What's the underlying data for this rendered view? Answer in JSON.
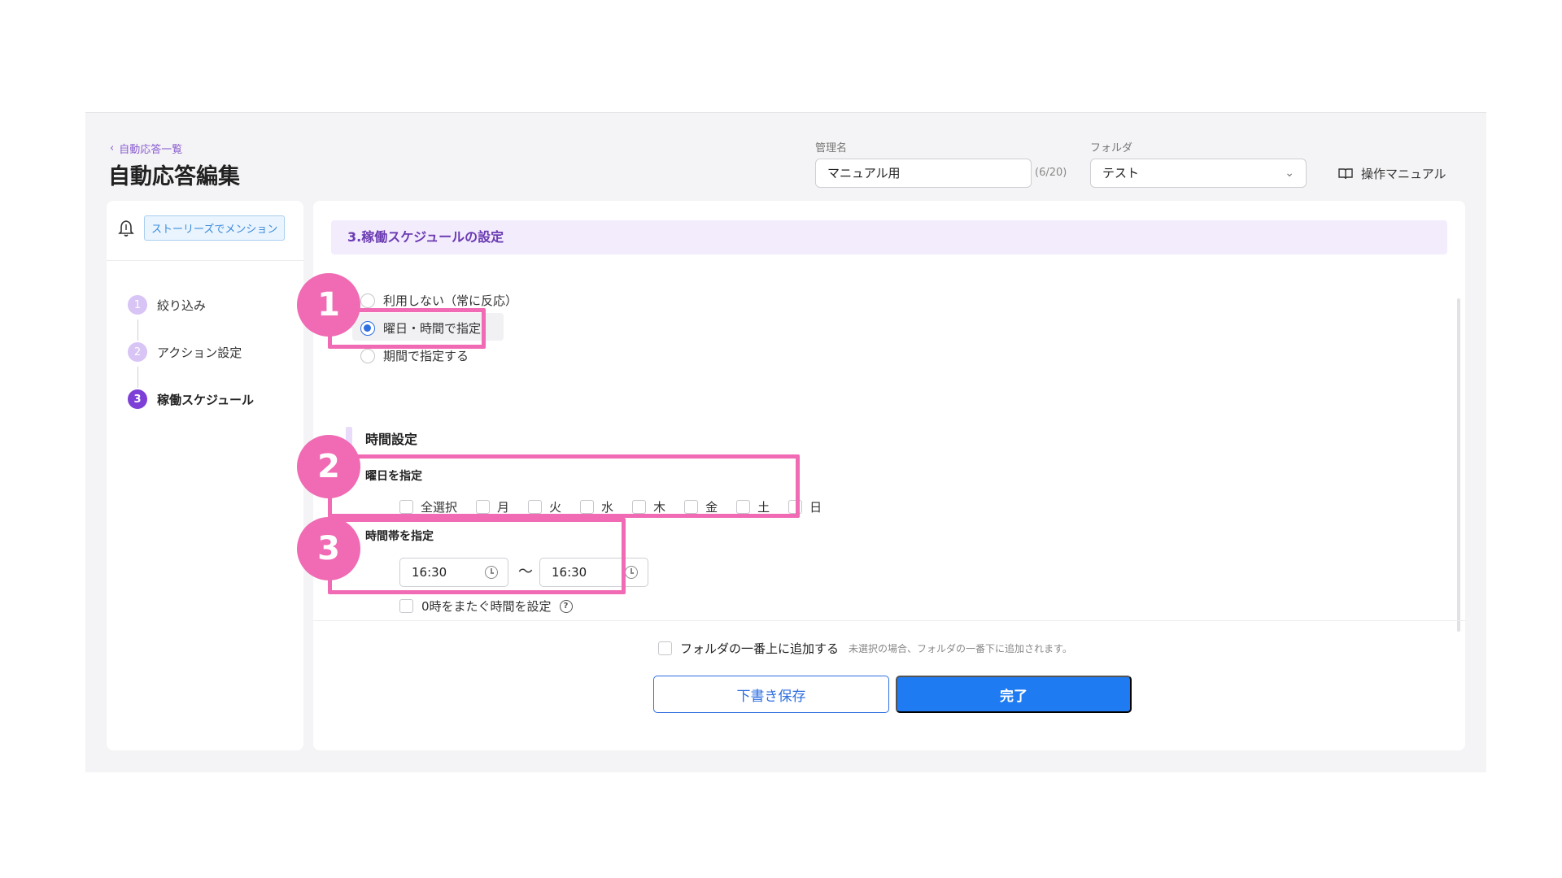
{
  "header": {
    "back_link": "自動応答一覧",
    "page_title": "自動応答編集",
    "name_label": "管理名",
    "name_value": "マニュアル用",
    "name_counter": "(6/20)",
    "folder_label": "フォルダ",
    "folder_value": "テスト",
    "manual_link": "操作マニュアル"
  },
  "sidebar": {
    "trigger_tag": "ストーリーズでメンション",
    "steps": [
      {
        "num": "1",
        "label": "絞り込み"
      },
      {
        "num": "2",
        "label": "アクション設定"
      },
      {
        "num": "3",
        "label": "稼働スケジュール"
      }
    ]
  },
  "schedule": {
    "section_title": "3.稼働スケジュールの設定",
    "options": [
      {
        "label": "利用しない（常に反応）",
        "selected": false
      },
      {
        "label": "曜日・時間で指定",
        "selected": true
      },
      {
        "label": "期間で指定する",
        "selected": false
      }
    ],
    "time_settings_title": "時間設定",
    "days_label": "曜日を指定",
    "days": [
      "全選択",
      "月",
      "火",
      "水",
      "木",
      "金",
      "土",
      "日"
    ],
    "timeband_label": "時間帯を指定",
    "start_time": "16:30",
    "tilde": "〜",
    "end_time": "16:30",
    "cross_midnight_label": "0時をまたぐ時間を設定",
    "help_glyph": "?"
  },
  "footer": {
    "add_top_label": "フォルダの一番上に追加する",
    "add_top_note": "未選択の場合、フォルダの一番下に追加されます。",
    "draft_button": "下書き保存",
    "done_button": "完了"
  },
  "annotations": {
    "badges": [
      "1",
      "2",
      "3"
    ],
    "color": "#f06ab4"
  },
  "colors": {
    "accent_purple": "#7d3fd6",
    "primary_blue": "#1f7bf2"
  }
}
